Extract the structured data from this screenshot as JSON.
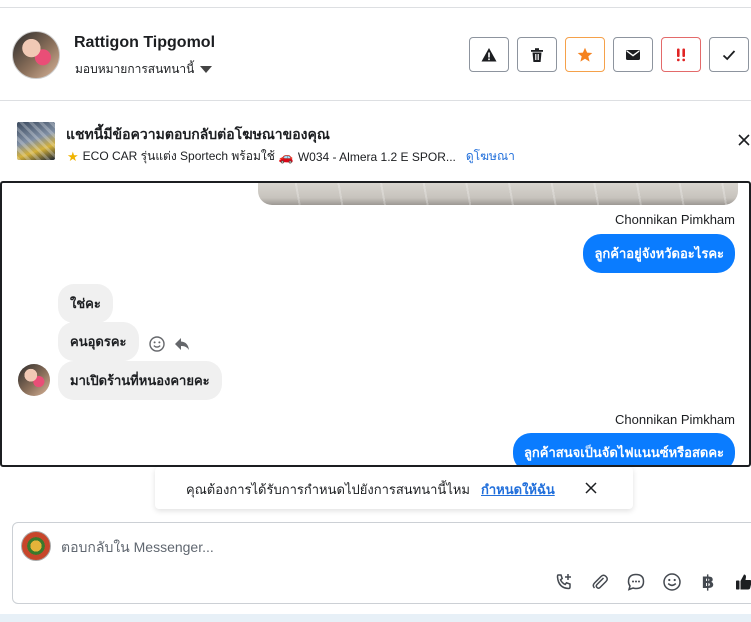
{
  "contact": {
    "name": "Rattigon Tipgomol",
    "assign_label": "มอบหมายการสนทนานี้"
  },
  "actions": [
    {
      "name": "report-spam-button",
      "icon": "warning-triangle-icon"
    },
    {
      "name": "delete-button",
      "icon": "trash-icon"
    },
    {
      "name": "star-button",
      "icon": "star-icon",
      "color": "#f5821f"
    },
    {
      "name": "mark-unread-button",
      "icon": "envelope-icon"
    },
    {
      "name": "mark-urgent-button",
      "icon": "double-exclamation-icon",
      "color": "#e02424"
    },
    {
      "name": "mark-done-button",
      "icon": "check-icon"
    }
  ],
  "ad_banner": {
    "title": "แชทนี้มีข้อความตอบกลับต่อโฆษณาของคุณ",
    "subtitle": "ECO CAR รุ่นแต่ง Sportech พร้อมใช้",
    "subtitle_cont": "W034 - Almera 1.2 E SPOR...",
    "link": "ดูโฆษณา"
  },
  "messages": {
    "sender_1": "Chonnikan Pimkham",
    "out_1": "ลูกค้าอยู่จังหวัดอะไรคะ",
    "in_1": "ใช่คะ",
    "in_2": "คนอุดรคะ",
    "in_3": "มาเปิดร้านที่หนองคายคะ",
    "sender_2": "Chonnikan Pimkham",
    "out_2": "ลูกค้าสนจเป็นจัดไฟแนนซ์หรือสดคะ"
  },
  "suggestion": {
    "text": "คุณต้องการได้รับการกำหนดไปยังการสนทนานี้ไหม",
    "link": "กำหนดให้ฉัน"
  },
  "composer": {
    "placeholder": "ตอบกลับใน Messenger...",
    "currency_symbol": "฿"
  },
  "colors": {
    "outgoing_bubble": "#0a7cff",
    "incoming_bubble": "#f0f0f0",
    "link": "#216fdb"
  }
}
